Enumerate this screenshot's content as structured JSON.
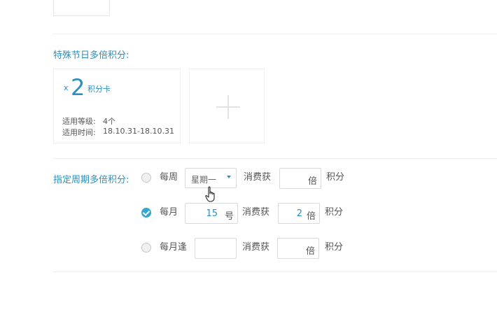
{
  "special_holiday": {
    "title": "特殊节日多倍积分:",
    "card": {
      "multiplier_prefix": "x",
      "multiplier_value": "2",
      "card_label": "积分卡",
      "level_label": "适用等级:",
      "level_value": "4个",
      "time_label": "适用时间:",
      "time_value": "18.10.31-18.10.31"
    },
    "add_icon": "plus-icon"
  },
  "period": {
    "title": "指定周期多倍积分:",
    "rows": [
      {
        "checked": false,
        "label": "每周",
        "select_value": "星期一",
        "consume_label": "消费获",
        "multiple_value": "",
        "multiple_unit": "倍",
        "points_label": "积分"
      },
      {
        "checked": true,
        "label": "每月",
        "day_value": "15",
        "day_unit": "号",
        "consume_label": "消费获",
        "multiple_value": "2",
        "multiple_unit": "倍",
        "points_label": "积分"
      },
      {
        "checked": false,
        "label": "每月逢",
        "input_value": "",
        "consume_label": "消费获",
        "multiple_value": "",
        "multiple_unit": "倍",
        "points_label": "积分"
      }
    ]
  },
  "colors": {
    "accent": "#2a8fbd",
    "checked": "#35a6d2"
  }
}
